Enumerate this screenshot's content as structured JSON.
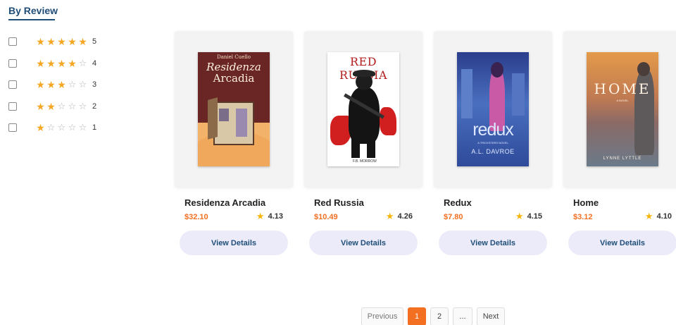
{
  "filter": {
    "title": "By Review",
    "ratings": [
      {
        "stars": 5,
        "label": "5"
      },
      {
        "stars": 4,
        "label": "4"
      },
      {
        "stars": 3,
        "label": "3"
      },
      {
        "stars": 2,
        "label": "2"
      },
      {
        "stars": 1,
        "label": "1"
      }
    ]
  },
  "books": [
    {
      "title": "Residenza Arcadia",
      "price": "$32.10",
      "rating": "4.13",
      "button": "View Details",
      "cover": {
        "author": "Daniel Cuello",
        "line1": "Residenza",
        "line2": "Arcadia"
      }
    },
    {
      "title": "Red Russia",
      "price": "$10.49",
      "rating": "4.26",
      "button": "View Details",
      "cover": {
        "line1": "RED RUSSIA",
        "author": "F.B. MORROW"
      }
    },
    {
      "title": "Redux",
      "price": "$7.80",
      "rating": "4.15",
      "button": "View Details",
      "cover": {
        "line1": "redux",
        "subtitle": "A TRICKSTERS NOVEL",
        "author": "A.L. DAVROE"
      }
    },
    {
      "title": "Home",
      "price": "$3.12",
      "rating": "4.10",
      "button": "View Details",
      "cover": {
        "line1": "HOME",
        "subtitle": "A NOVEL",
        "author": "LYNNE LYTTLE"
      }
    }
  ],
  "pagination": {
    "previous": "Previous",
    "pages": [
      "1",
      "2"
    ],
    "ellipsis": "...",
    "next": "Next",
    "current": "1"
  },
  "colors": {
    "accent": "#f36f21",
    "heading": "#1f4e79",
    "star": "#f5a623",
    "button_bg": "#ecebfa"
  }
}
